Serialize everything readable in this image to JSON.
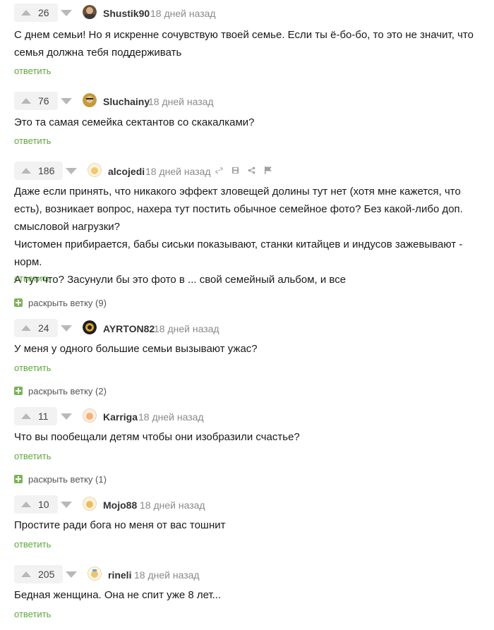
{
  "comments": [
    {
      "score": "26",
      "user": "Shustik90",
      "time": "18 дней назад",
      "lines": [
        "С днем семьи! Но я искренне сочувствую твоей семье. Если ты ё-бо-бо, то это не значит, что",
        "семья должна тебя поддерживать"
      ],
      "reply": "ответить"
    },
    {
      "score": "76",
      "user": "Sluchainy",
      "time": "18 дней назад",
      "lines": [
        "Это та самая семейка сектантов со скакалками?"
      ],
      "reply": "ответить"
    },
    {
      "score": "186",
      "user": "alcojedi",
      "time": "18 дней назад",
      "lines": [
        "Даже если принять, что никакого эффект зловещей долины тут нет (хотя мне кажется, что",
        "есть), возникает вопрос, нахера тут постить обычное семейное фото? Без какой-либо доп.",
        "смысловой нагрузки?",
        "Чистомен прибирается, бабы сиськи показывают, станки китайцев и индусов зажевывают - норм.",
        "А тут что? Засунули бы это фото в ... свой семейный альбом, и все"
      ],
      "reply": "ответить",
      "expand": "раскрыть ветку (9)"
    },
    {
      "score": "24",
      "user": "AYRTON82",
      "time": "18 дней назад",
      "lines": [
        "У меня у одного большие семьи вызывают ужас?"
      ],
      "reply": "ответить",
      "expand": "раскрыть ветку (2)"
    },
    {
      "score": "11",
      "user": "Karriga",
      "time": "18 дней назад",
      "lines": [
        "Что вы пообещали детям чтобы они изобразили счастье?"
      ],
      "reply": "ответить",
      "expand": "раскрыть ветку (1)"
    },
    {
      "score": "10",
      "user": "Mojo88",
      "time": "18 дней назад",
      "lines": [
        "Простите ради бога но меня от вас тошнит"
      ],
      "reply": "ответить"
    },
    {
      "score": "205",
      "user": "rineli",
      "time": "18 дней назад",
      "lines": [
        "Бедная женщина. Она не спит уже 8 лет..."
      ],
      "reply": "ответить"
    }
  ],
  "colors": {
    "accent": "#60a73b",
    "expand": "#7ab356",
    "muted": "#8a8a8a",
    "vote_bg": "#f2f2f2"
  },
  "icons": [
    "arrow-up-icon",
    "arrow-down-icon",
    "link-icon",
    "save-icon",
    "share-icon",
    "flag-icon",
    "plus-icon"
  ]
}
